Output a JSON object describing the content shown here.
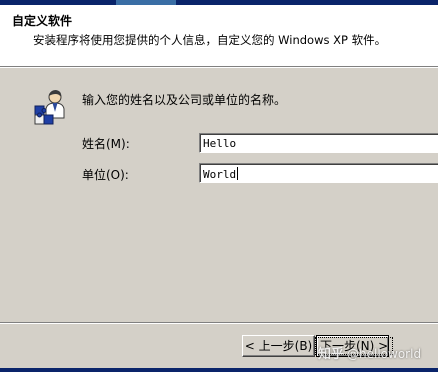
{
  "header": {
    "title": "自定义软件",
    "description": "安装程序将使用您提供的个人信息，自定义您的 Windows XP 软件。"
  },
  "prompt": "输入您的姓名以及公司或单位的名称。",
  "fields": {
    "name": {
      "label": "姓名(M):",
      "value": "Hello"
    },
    "organization": {
      "label": "单位(O):",
      "value": "World"
    }
  },
  "buttons": {
    "back": "< 上一步(B)",
    "next": "下一步(N) >"
  },
  "watermark": {
    "logo": "知乎",
    "handle": "@helloworld"
  },
  "colors": {
    "dialog_bg": "#d4d0c8",
    "title_bar": "#0a246a",
    "header_bg": "#ffffff"
  },
  "icons": {
    "wizard": "user-with-puzzle-icon"
  }
}
